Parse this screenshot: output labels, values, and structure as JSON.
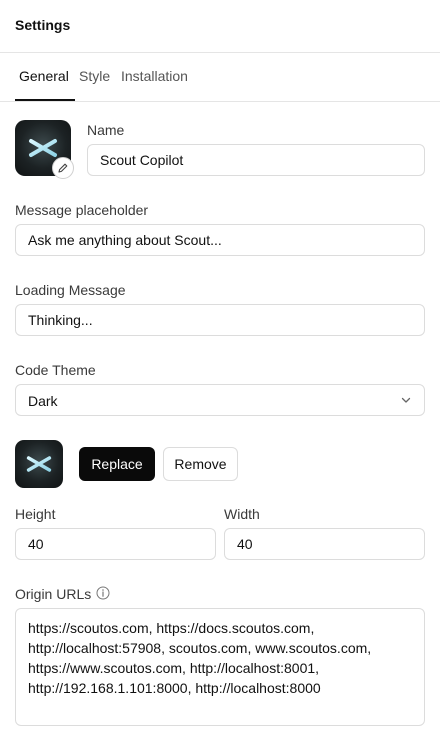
{
  "header": {
    "title": "Settings"
  },
  "tabs": [
    {
      "label": "General",
      "active": true
    },
    {
      "label": "Style",
      "active": false
    },
    {
      "label": "Installation",
      "active": false
    }
  ],
  "name": {
    "label": "Name",
    "value": "Scout Copilot"
  },
  "message_placeholder": {
    "label": "Message placeholder",
    "value": "Ask me anything about Scout..."
  },
  "loading_message": {
    "label": "Loading Message",
    "value": "Thinking..."
  },
  "code_theme": {
    "label": "Code Theme",
    "selected": "Dark"
  },
  "icon_actions": {
    "replace_label": "Replace",
    "remove_label": "Remove"
  },
  "height": {
    "label": "Height",
    "value": "40"
  },
  "width": {
    "label": "Width",
    "value": "40"
  },
  "origin_urls": {
    "label": "Origin URLs",
    "value": "https://scoutos.com, https://docs.scoutos.com, http://localhost:57908, scoutos.com, www.scoutos.com, https://www.scoutos.com, http://localhost:8001, http://192.168.1.101:8000, http://localhost:8000"
  },
  "icons": {
    "logo": "scout-asterisk-logo-icon",
    "edit": "pencil-icon",
    "chevron": "chevron-down-icon",
    "info": "info-icon"
  },
  "colors": {
    "primary_button": "#0a0a0a",
    "border": "#dcdcdc",
    "tab_active": "#111111"
  }
}
